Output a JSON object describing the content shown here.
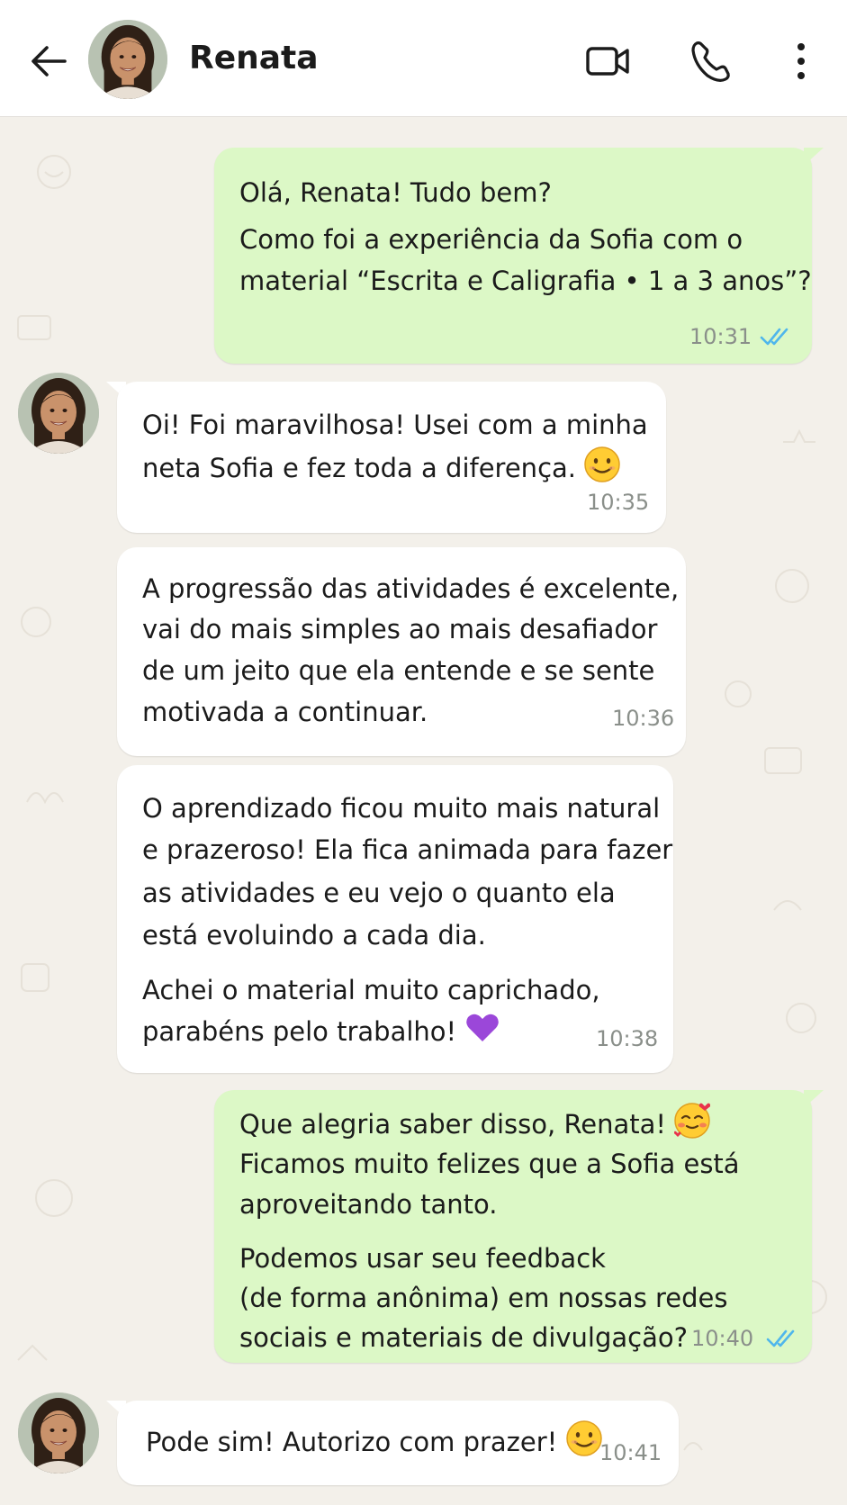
{
  "header": {
    "contact_name": "Renata",
    "icons": [
      "back-arrow-icon",
      "video-call-icon",
      "phone-icon",
      "more-vert-icon"
    ]
  },
  "colors": {
    "outgoing_bubble": "#dcf8c6",
    "incoming_bubble": "#ffffff",
    "chat_background": "#f3f0ea",
    "read_ticks": "#4fb6ec",
    "timestamp": "#8a8f8a"
  },
  "messages": [
    {
      "direction": "outgoing",
      "lines": [
        "Olá, Renata! Tudo bem?",
        "Como foi a experiência da Sofia com o",
        "material “Escrita e Caligrafia • 1 a 3 anos”?"
      ],
      "time": "10:31",
      "status": "read"
    },
    {
      "direction": "incoming",
      "lines": [
        "Oi! Foi maravilhosa! Usei com a minha",
        "neta Sofia e fez toda a diferença."
      ],
      "emoji": "smiling-face-icon",
      "time": "10:35"
    },
    {
      "direction": "incoming",
      "lines": [
        "A progressão das atividades é excelente,",
        "vai do mais simples ao mais desafiador",
        "de um jeito que ela entende e se sente",
        "motivada a continuar."
      ],
      "time": "10:36"
    },
    {
      "direction": "incoming",
      "lines": [
        "O aprendizado ficou muito mais natural",
        "e prazeroso! Ela fica animada para fazer",
        "as atividades e eu vejo o quanto ela",
        "está evoluindo a cada dia.",
        "Achei o material muito caprichado,",
        "parabéns pelo trabalho!"
      ],
      "emoji": "purple-heart-icon",
      "time": "10:38"
    },
    {
      "direction": "outgoing",
      "lines": [
        "Que alegria saber disso, Renata!",
        "Ficamos muito felizes que a Sofia está",
        "aproveitando tanto.",
        "Podemos usar seu feedback",
        "(de forma anônima) em nossas redes",
        "sociais e materiais de divulgação?"
      ],
      "emoji": "smiling-face-with-hearts-icon",
      "time": "10:40",
      "status": "read"
    },
    {
      "direction": "incoming",
      "lines": [
        "Pode sim! Autorizo com prazer!"
      ],
      "emoji": "smiling-face-icon",
      "time": "10:41"
    }
  ]
}
